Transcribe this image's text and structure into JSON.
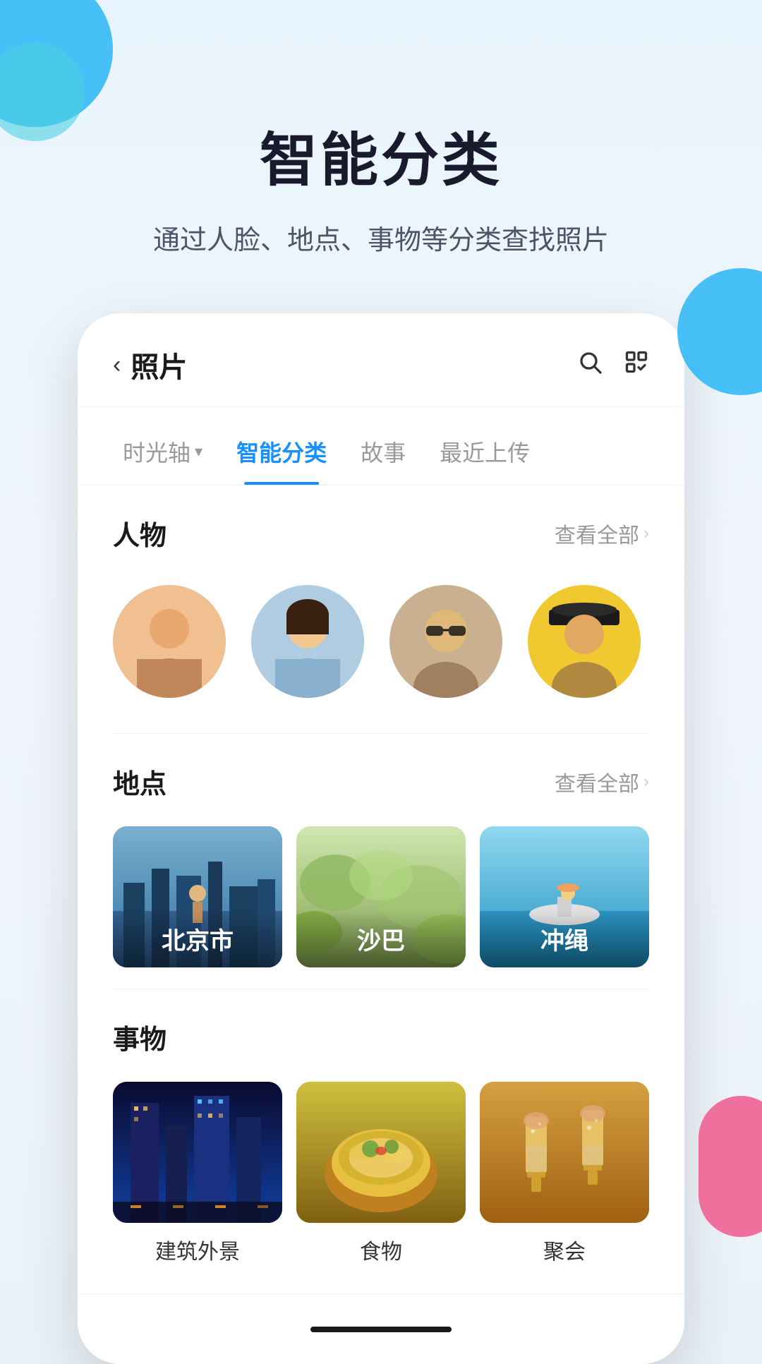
{
  "hero": {
    "title": "智能分类",
    "subtitle": "通过人脸、地点、事物等分类查找照片"
  },
  "phone": {
    "header": {
      "back_label": "‹",
      "title": "照片",
      "search_icon": "search",
      "select_icon": "select"
    },
    "tabs": [
      {
        "id": "timeline",
        "label": "时光轴",
        "has_dropdown": true,
        "active": false
      },
      {
        "id": "smart",
        "label": "智能分类",
        "has_dropdown": false,
        "active": true
      },
      {
        "id": "story",
        "label": "故事",
        "has_dropdown": false,
        "active": false
      },
      {
        "id": "recent",
        "label": "最近上传",
        "has_dropdown": false,
        "active": false
      }
    ],
    "sections": {
      "people": {
        "title": "人物",
        "view_all": "查看全部",
        "avatars": [
          {
            "id": 1,
            "color": "avatar-1",
            "emoji": "👧"
          },
          {
            "id": 2,
            "color": "avatar-2",
            "emoji": "👩"
          },
          {
            "id": 3,
            "color": "avatar-3",
            "emoji": "🧔"
          },
          {
            "id": 4,
            "color": "avatar-4",
            "emoji": "👒"
          }
        ]
      },
      "locations": {
        "title": "地点",
        "view_all": "查看全部",
        "items": [
          {
            "id": 1,
            "label": "北京市",
            "color": "loc-1"
          },
          {
            "id": 2,
            "label": "沙巴",
            "color": "loc-2"
          },
          {
            "id": 3,
            "label": "冲绳",
            "color": "loc-3"
          }
        ]
      },
      "things": {
        "title": "事物",
        "items": [
          {
            "id": 1,
            "label": "建筑外景",
            "color": "thing-1"
          },
          {
            "id": 2,
            "label": "食物",
            "color": "thing-2"
          },
          {
            "id": 3,
            "label": "聚会",
            "color": "thing-3"
          }
        ]
      }
    }
  },
  "colors": {
    "accent_blue": "#1890ff",
    "text_primary": "#1a1a1a",
    "text_secondary": "#999999"
  }
}
